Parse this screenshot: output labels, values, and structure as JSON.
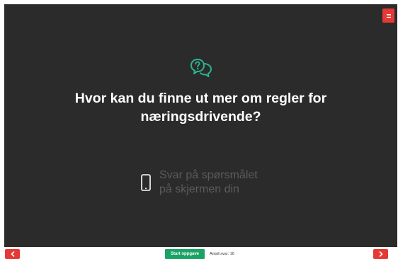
{
  "question": {
    "line1": "Hvor kan du finne ut mer om regler for",
    "line2": "næringsdrivende?"
  },
  "answer_hint": {
    "line1": "Svar på spørsmålet",
    "line2": "på skjermen din"
  },
  "footer": {
    "start_label": "Start oppgave",
    "answer_count": "Antall svar: 16"
  },
  "colors": {
    "stage_bg": "#2b2b2b",
    "accent_red": "#e53935",
    "accent_green": "#1aa366",
    "icon_teal": "#2bb38f"
  },
  "icons": {
    "menu": "hamburger-menu-icon",
    "question": "speech-bubbles-question-icon",
    "phone": "smartphone-icon",
    "prev": "chevron-left-icon",
    "next": "chevron-right-icon"
  }
}
